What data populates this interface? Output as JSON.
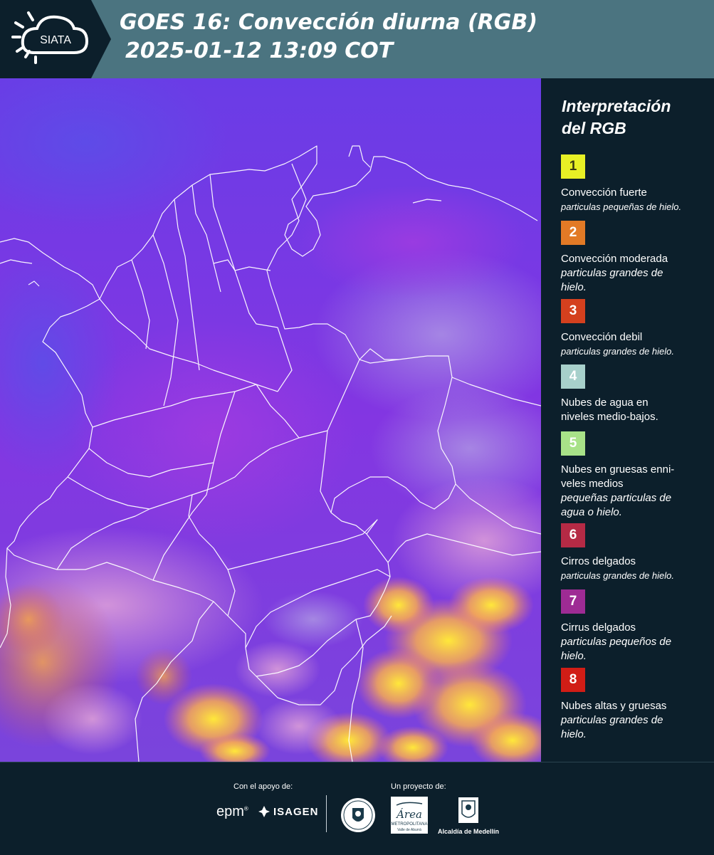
{
  "header": {
    "logo_text": "SIATA",
    "title_line1": "GOES 16: Convección diurna (RGB)",
    "title_line2": "2025-01-12 13:09 COT"
  },
  "legend": {
    "title_line1": "Interpretación",
    "title_line2": "del RGB",
    "items": [
      {
        "number": "1",
        "color": "#e8f025",
        "text_color": "#3a3a12",
        "label": "Convección fuerte",
        "sub": "particulas pequeñas de hielo."
      },
      {
        "number": "2",
        "color": "#e27a26",
        "text_color": "#ffffff",
        "label": "Convección moderada",
        "sub": "particulas grandes de hielo."
      },
      {
        "number": "3",
        "color": "#d4401e",
        "text_color": "#ffffff",
        "label": "Convección debil",
        "sub": "particulas grandes de hielo."
      },
      {
        "number": "4",
        "color": "#a7d0cb",
        "text_color": "#ffffff",
        "label": "Nubes de agua en niveles medio-bajos.",
        "sub": ""
      },
      {
        "number": "5",
        "color": "#a8e288",
        "text_color": "#ffffff",
        "label": "Nubes en gruesas enni-veles medios",
        "sub": "pequeñas particulas de agua o hielo."
      },
      {
        "number": "6",
        "color": "#b52a45",
        "text_color": "#ffffff",
        "label": "Cirros delgados",
        "sub": "particulas grandes de hielo."
      },
      {
        "number": "7",
        "color": "#9e2b94",
        "text_color": "#ffffff",
        "label": "Cirrus delgados",
        "sub": "particulas pequeños de hielo."
      },
      {
        "number": "8",
        "color": "#d11d16",
        "text_color": "#ffffff",
        "label": "Nubes altas y gruesas",
        "sub": "particulas grandes de hielo."
      }
    ]
  },
  "footer": {
    "support_caption": "Con el apoyo de:",
    "project_caption": "Un proyecto de:",
    "sponsor1": "epm",
    "sponsor2": "ISAGEN",
    "partner_area_word": "Área",
    "partner_area_sub1": "METROPOLITANA",
    "partner_area_sub2": "Valle de Aburrá",
    "partner_alcaldia": "Alcaldía de Medellín"
  },
  "colors": {
    "header_bg": "#4b7480",
    "page_bg": "#0c1f2b",
    "map_base": "#7a3fe0",
    "border_lines": "#ffffff"
  }
}
